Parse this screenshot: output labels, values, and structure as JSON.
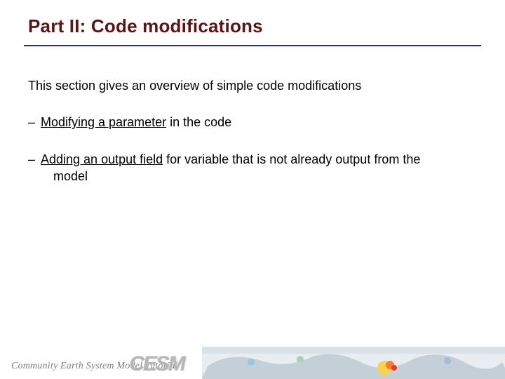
{
  "title": "Part II: Code modifications",
  "intro": "This section gives an overview of simple code modifications",
  "bullets": [
    {
      "dash": "–",
      "underline": "Modifying a parameter",
      "rest": " in the code"
    },
    {
      "dash": "–",
      "underline": "Adding an output field",
      "rest": " for variable that is not already output from the",
      "cont": "model"
    }
  ],
  "footer": {
    "text": "Community Earth System Model Tutorial",
    "logo": "CESM"
  }
}
